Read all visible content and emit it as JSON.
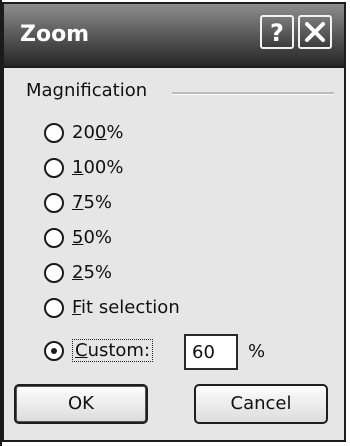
{
  "dialog": {
    "title": "Zoom",
    "help_icon": "question-mark-icon",
    "close_icon": "close-x-icon"
  },
  "magnification": {
    "group_label": "Magnification",
    "options": [
      {
        "pre": "20",
        "ul": "0",
        "post": "%",
        "selected": false
      },
      {
        "pre": "",
        "ul": "1",
        "post": "00%",
        "selected": false
      },
      {
        "pre": "",
        "ul": "7",
        "post": "5%",
        "selected": false
      },
      {
        "pre": "",
        "ul": "5",
        "post": "0%",
        "selected": false
      },
      {
        "pre": "",
        "ul": "2",
        "post": "5%",
        "selected": false
      },
      {
        "pre": "",
        "ul": "F",
        "post": "it selection",
        "selected": false
      },
      {
        "pre": "",
        "ul": "C",
        "post": "ustom:",
        "selected": true
      }
    ],
    "custom_value": "60",
    "percent_sign": "%"
  },
  "buttons": {
    "ok": "OK",
    "cancel": "Cancel"
  }
}
